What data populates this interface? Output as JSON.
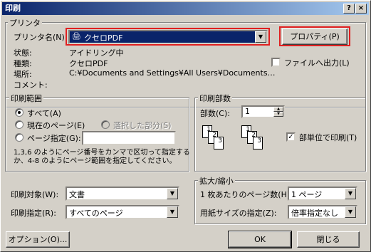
{
  "window": {
    "title": "印刷",
    "help_label": "?",
    "close_label": "×"
  },
  "printer": {
    "group_label": "プリンタ",
    "name_label": "プリンタ名(N):",
    "name_value": "クセロPDF",
    "properties_button": "プロパティ(P)",
    "status_label": "状態:",
    "status_value": "アイドリング中",
    "type_label": "種類:",
    "type_value": "クセロPDF",
    "location_label": "場所:",
    "location_value": "C:¥Documents and Settings¥All Users¥Documents…",
    "comment_label": "コメント:",
    "print_to_file_label": "ファイルへ出力(L)",
    "print_to_file_checked": false
  },
  "range": {
    "group_label": "印刷範囲",
    "all_label": "すべて(A)",
    "current_label": "現在のページ(E)",
    "selection_label": "選択した部分(S)",
    "pages_label": "ページ指定(G):",
    "pages_value": "",
    "hint": "1,3,6 のようにページ番号をカンマで区切って指定する\nか、4-8 のようにページ範囲を指定してください。"
  },
  "copies": {
    "group_label": "印刷部数",
    "count_label": "部数(C):",
    "count_value": "1",
    "collate_label": "部単位で印刷(T)",
    "collate_checked": true
  },
  "what": {
    "target_label": "印刷対象(W):",
    "target_value": "文書",
    "spec_label": "印刷指定(R):",
    "spec_value": "すべてのページ"
  },
  "zoom": {
    "group_label": "拡大/縮小",
    "pps_label": "1 枚あたりのページ数(H):",
    "pps_value": "1 ページ",
    "scale_label": "用紙サイズの指定(Z):",
    "scale_value": "倍率指定なし"
  },
  "footer": {
    "options_button": "オプション(O)...",
    "ok_button": "OK",
    "close_button": "閉じる"
  }
}
